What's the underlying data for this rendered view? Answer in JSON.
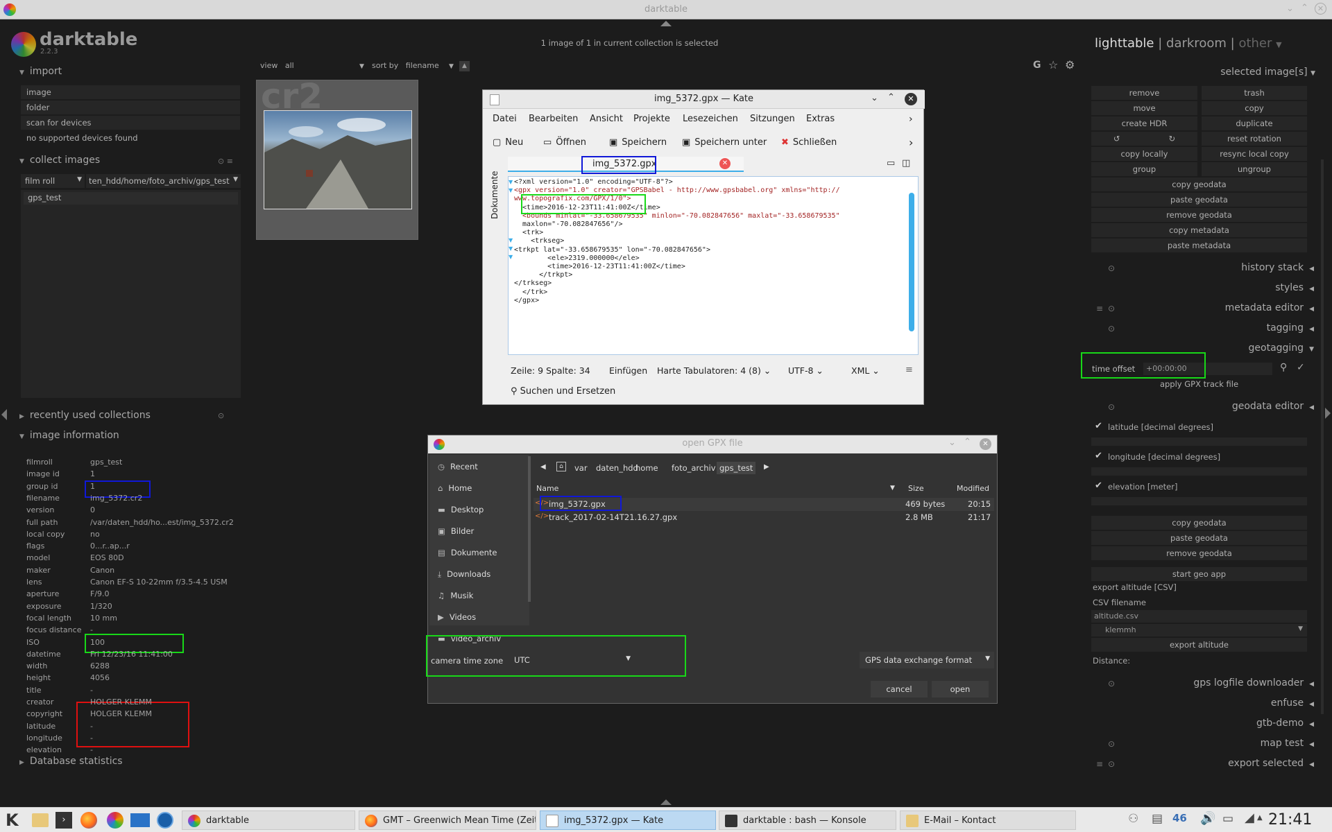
{
  "window": {
    "title": "darktable"
  },
  "header": {
    "app_name": "darktable",
    "version": "2.2.3",
    "collection_status": "1 image of 1 in current collection is selected",
    "views": {
      "lighttable": "lighttable",
      "sep1": "|",
      "darkroom": "darkroom",
      "sep2": "|",
      "other": "other"
    }
  },
  "toolbar": {
    "view_label": "view",
    "view_value": "all",
    "sort_label": "sort by",
    "sort_value": "filename",
    "thumb_ext": "cr2"
  },
  "left_panel": {
    "import": {
      "title": "import",
      "buttons": [
        "image",
        "folder",
        "scan for devices",
        "no supported devices found"
      ]
    },
    "collect": {
      "title": "collect images",
      "property": "film roll",
      "path": "ten_hdd/home/foto_archiv/gps_test",
      "item": "gps_test"
    },
    "recent": {
      "title": "recently used collections"
    },
    "info": {
      "title": "image information",
      "rows": [
        {
          "k": "filmroll",
          "v": "gps_test"
        },
        {
          "k": "image id",
          "v": "1"
        },
        {
          "k": "group id",
          "v": "1"
        },
        {
          "k": "filename",
          "v": "img_5372.cr2"
        },
        {
          "k": "version",
          "v": "0"
        },
        {
          "k": "full path",
          "v": "/var/daten_hdd/ho...est/img_5372.cr2"
        },
        {
          "k": "local copy",
          "v": "no"
        },
        {
          "k": "flags",
          "v": "0...r..ap...r"
        },
        {
          "k": "model",
          "v": "EOS 80D"
        },
        {
          "k": "maker",
          "v": "Canon"
        },
        {
          "k": "lens",
          "v": "Canon EF-S 10-22mm f/3.5-4.5 USM"
        },
        {
          "k": "aperture",
          "v": "F/9.0"
        },
        {
          "k": "exposure",
          "v": "1/320"
        },
        {
          "k": "focal length",
          "v": "10 mm"
        },
        {
          "k": "focus distance",
          "v": "-"
        },
        {
          "k": "ISO",
          "v": "100"
        },
        {
          "k": "datetime",
          "v": "Fri 12/23/16 11:41:00"
        },
        {
          "k": "width",
          "v": "6288"
        },
        {
          "k": "height",
          "v": "4056"
        },
        {
          "k": "title",
          "v": "-"
        },
        {
          "k": "creator",
          "v": "HOLGER KLEMM"
        },
        {
          "k": "copyright",
          "v": "HOLGER KLEMM"
        },
        {
          "k": "latitude",
          "v": "-"
        },
        {
          "k": "longitude",
          "v": "-"
        },
        {
          "k": "elevation",
          "v": "-"
        }
      ]
    },
    "db_stats": {
      "title": "Database statistics"
    }
  },
  "right_panel": {
    "selected": {
      "title": "selected image[s]",
      "buttons": [
        [
          "remove",
          "trash"
        ],
        [
          "move",
          "copy"
        ],
        [
          "create HDR",
          "duplicate"
        ],
        [
          "",
          "reset rotation"
        ],
        [
          "copy locally",
          "resync local copy"
        ],
        [
          "group",
          "ungroup"
        ]
      ],
      "wide": [
        "copy geodata",
        "paste geodata",
        "remove geodata",
        "copy metadata",
        "paste metadata"
      ]
    },
    "sections1": [
      "history stack",
      "styles",
      "metadata editor",
      "tagging",
      "geotagging"
    ],
    "geotag": {
      "label": "time offset",
      "value": "+00:00:00",
      "apply": "apply GPX track file"
    },
    "geodata": {
      "title": "geodata editor",
      "fields": [
        "latitude [decimal degrees]",
        "longitude [decimal degrees]",
        "elevation [meter]"
      ],
      "buttons": [
        "copy geodata",
        "paste geodata",
        "remove geodata",
        "start geo app"
      ],
      "export_title": "export altitude [CSV]",
      "csv_label": "CSV filename",
      "csv_value": "altitude.csv",
      "user": "klemmh",
      "export_btn": "export altitude",
      "distance": "Distance:"
    },
    "sections2": [
      "gps logfile downloader",
      "enfuse",
      "gtb-demo",
      "map test",
      "export selected"
    ]
  },
  "kate": {
    "title": "img_5372.gpx  — Kate",
    "menu": [
      "Datei",
      "Bearbeiten",
      "Ansicht",
      "Projekte",
      "Lesezeichen",
      "Sitzungen",
      "Extras"
    ],
    "toolbar": [
      "Neu",
      "Öffnen",
      "Speichern",
      "Speichern unter",
      "Schließen"
    ],
    "sidebar": "Dokumente",
    "tab": "img_5372.gpx",
    "code": [
      "<?xml version=\"1.0\" encoding=\"UTF-8\"?>",
      "<gpx version=\"1.0\" creator=\"GPSBabel - http://www.gpsbabel.org\" xmlns=\"http://",
      "www.topografix.com/GPX/1/0\">",
      "  <time>2016-12-23T11:41:00Z</time>",
      "  <bounds minlat=\"-33.658679535\" minlon=\"-70.082847656\" maxlat=\"-33.658679535\"",
      "  maxlon=\"-70.082847656\"/>",
      "  <trk>",
      "    <trkseg>",
      "<trkpt lat=\"-33.658679535\" lon=\"-70.082847656\">",
      "        <ele>2319.000000</ele>",
      "        <time>2016-12-23T11:41:00Z</time>",
      "      </trkpt>",
      "</trkseg>",
      "  </trk>",
      "</gpx>"
    ],
    "status": {
      "pos": "Zeile: 9 Spalte: 34",
      "mode": "Einfügen",
      "tabs": "Harte Tabulatoren: 4 (8)",
      "enc": "UTF-8",
      "syntax": "XML"
    },
    "search": "Suchen und Ersetzen"
  },
  "gpx_dialog": {
    "title": "open GPX file",
    "places": [
      "Recent",
      "Home",
      "Desktop",
      "Bilder",
      "Dokumente",
      "Downloads",
      "Musik",
      "Videos",
      "video_archiv"
    ],
    "crumbs": [
      "var",
      "daten_hdd",
      "home",
      "foto_archiv",
      "gps_test"
    ],
    "headers": {
      "name": "Name",
      "size": "Size",
      "modified": "Modified"
    },
    "files": [
      {
        "name": "img_5372.gpx",
        "size": "469 bytes",
        "modified": "20:15"
      },
      {
        "name": "track_2017-02-14T21.16.27.gpx",
        "size": "2.8 MB",
        "modified": "21:17"
      }
    ],
    "tz_label": "camera time zone",
    "tz_value": "UTC",
    "filter": "GPS data exchange format",
    "cancel": "cancel",
    "open": "open"
  },
  "taskbar": {
    "tasks": [
      "darktable",
      "GMT – Greenwich Mean Time (Zeitz",
      "img_5372.gpx  — Kate",
      "darktable : bash — Konsole",
      "E-Mail – Kontact"
    ],
    "clock": "21:41"
  }
}
